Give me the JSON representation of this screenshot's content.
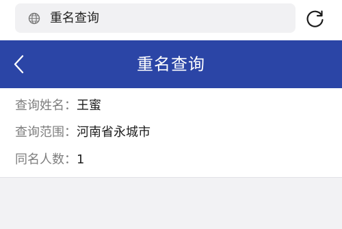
{
  "browser": {
    "url_text": "重名查询",
    "globe_icon": "globe-icon",
    "reload_icon": "reload-icon"
  },
  "header": {
    "title": "重名查询",
    "back_icon": "chevron-left-icon",
    "background_color": "#2b45a6"
  },
  "result": {
    "rows": [
      {
        "label": "查询姓名：",
        "value": "王蜜"
      },
      {
        "label": "查询范围：",
        "value": "河南省永城市"
      },
      {
        "label": "同名人数：",
        "value": "1"
      }
    ]
  }
}
